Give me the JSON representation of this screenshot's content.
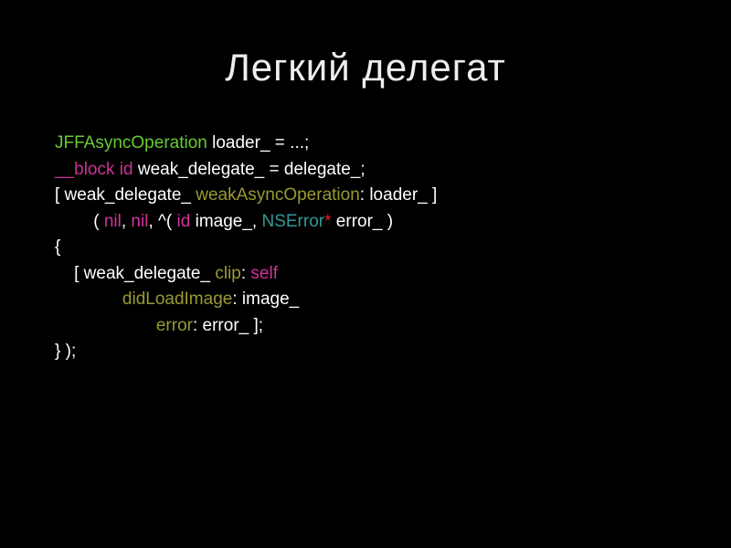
{
  "title": "Легкий делегат",
  "code": {
    "l1": {
      "t1": "JFFAsyncOperation",
      "t2": " loader_ = ...;"
    },
    "l2": {
      "t1": "__block",
      "t2": " ",
      "t3": "id",
      "t4": " weak_delegate_ = delegate_;"
    },
    "l3": {
      "t1": "[ weak_delegate_ ",
      "t2": "weakAsyncOperation",
      "t3": ": loader_ ]"
    },
    "l4": {
      "t1": "        ( ",
      "t2": "nil",
      "t3": ", ",
      "t4": "nil",
      "t5": ", ^( ",
      "t6": "id",
      "t7": " image_, ",
      "t8": "NSError",
      "t9": "*",
      "t10": " error_ )"
    },
    "l5": "{",
    "l6": {
      "t1": "    [ weak_delegate_ ",
      "t2": "clip",
      "t3": ": ",
      "t4": "self"
    },
    "l7": {
      "t1": "              ",
      "t2": "didLoadImage",
      "t3": ": image_"
    },
    "l8": {
      "t1": "                     ",
      "t2": "error",
      "t3": ": error_ ];"
    },
    "l9": "} );"
  }
}
